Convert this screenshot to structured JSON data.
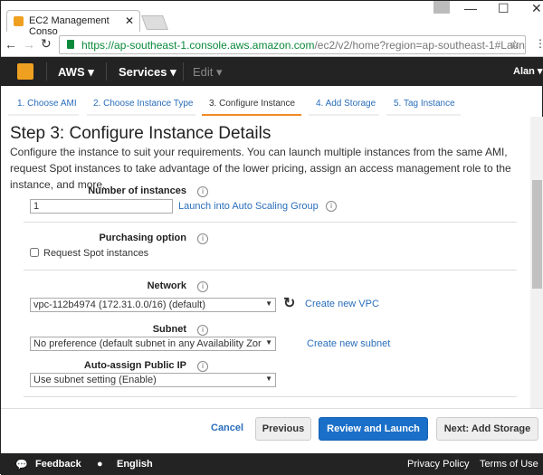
{
  "browser": {
    "tab_title": "EC2 Management Conso",
    "url_host": "https://ap-southeast-1.console.aws.amazon.com",
    "url_path": "/ec2/v2/home?region=ap-southeast-1#Launcl"
  },
  "nav": {
    "aws": "AWS ▾",
    "services": "Services ▾",
    "edit": "Edit ▾",
    "user": "Alan ▾"
  },
  "steps": [
    {
      "label": "1. Choose AMI"
    },
    {
      "label": "2. Choose Instance Type"
    },
    {
      "label": "3. Configure Instance",
      "active": true
    },
    {
      "label": "4. Add Storage"
    },
    {
      "label": "5. Tag Instance"
    }
  ],
  "accent": "#f08a24",
  "page": {
    "title": "Step 3: Configure Instance Details",
    "description": "Configure the instance to suit your requirements. You can launch multiple instances from the same AMI, request Spot instances to take advantage of the lower pricing, assign an access management role to the instance, and more."
  },
  "form": {
    "num_instances_label": "Number of instances",
    "num_instances_value": "1",
    "auto_scaling_link": "Launch into Auto Scaling Group",
    "purchasing_label": "Purchasing option",
    "spot_label": "Request Spot instances",
    "spot_checked": false,
    "network_label": "Network",
    "network_value": "vpc-112b4974 (172.31.0.0/16) (default)",
    "create_vpc": "Create new VPC",
    "subnet_label": "Subnet",
    "subnet_value": "No preference (default subnet in any Availability Zor",
    "create_subnet": "Create new subnet",
    "public_ip_label": "Auto-assign Public IP",
    "public_ip_value": "Use subnet setting (Enable)"
  },
  "actions": {
    "cancel": "Cancel",
    "previous": "Previous",
    "review": "Review and Launch",
    "next": "Next: Add Storage"
  },
  "footer": {
    "feedback": "Feedback",
    "language": "English",
    "privacy": "Privacy Policy",
    "terms": "Terms of Use"
  }
}
